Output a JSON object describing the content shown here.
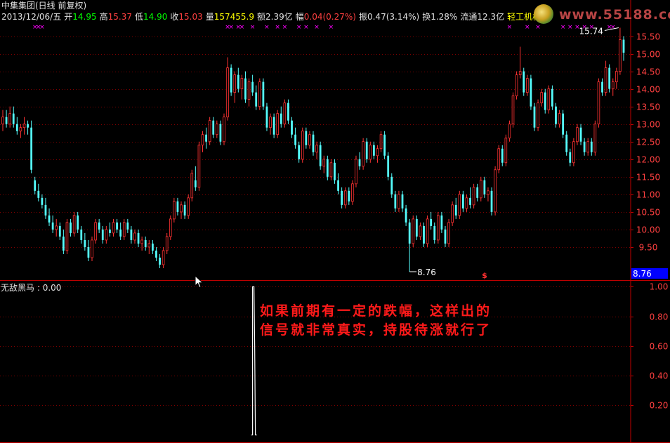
{
  "header": {
    "title": "中集集团(日线 前复权)",
    "date": "2013/12/06/五",
    "open_label": "开",
    "open": "14.95",
    "high_label": "高",
    "high": "15.37",
    "low_label": "低",
    "low": "14.90",
    "close_label": "收",
    "close": "15.03",
    "volume_label": "量",
    "volume": "157455.9",
    "amount_label": "额",
    "amount": "2.39亿",
    "change_label": "幅",
    "change": "0.04(0.27%)",
    "amplitude_label": "振",
    "amplitude": "0.47(3.14%)",
    "turnover_label": "换",
    "turnover": "1.28%",
    "float_label": "流通",
    "float_cap": "12.3亿",
    "sector": "轻工机械"
  },
  "indicator": {
    "name": "无敌黑马",
    "value": "0.00"
  },
  "annotation": {
    "line1": "如果前期有一定的跌幅，这样出的",
    "line2": "信号就非常真实，持股待涨就行了"
  },
  "watermark": {
    "text": "www.55188.com"
  },
  "colors": {
    "up": "#ff3232",
    "down": "#54fcfc",
    "grid": "#800000",
    "axis": "#c00000",
    "marker": "#ff00ff",
    "price_tag": "#0000ff",
    "indicator_line": "#ffffff",
    "annotation": "#ff1a1a"
  },
  "chart_data": [
    {
      "type": "candlestick",
      "y_ticks": [
        9.5,
        10.0,
        10.5,
        11.0,
        11.5,
        12.0,
        12.5,
        13.0,
        13.5,
        14.0,
        14.5,
        15.0,
        15.5
      ],
      "ylim": [
        8.58,
        15.93
      ],
      "period_high": 15.74,
      "period_low": 8.76,
      "current_price_tag": "8.76",
      "high_label": "15.74",
      "low_label": "8.76",
      "candles": [
        {
          "o": 13.0,
          "h": 13.4,
          "l": 12.8,
          "c": 13.2
        },
        {
          "o": 13.2,
          "h": 13.4,
          "l": 12.9,
          "c": 13.0
        },
        {
          "o": 13.0,
          "h": 13.5,
          "l": 12.9,
          "c": 13.3
        },
        {
          "o": 13.3,
          "h": 13.5,
          "l": 12.9,
          "c": 13.0
        },
        {
          "o": 13.0,
          "h": 13.2,
          "l": 12.7,
          "c": 12.8
        },
        {
          "o": 12.8,
          "h": 13.0,
          "l": 12.6,
          "c": 12.9
        },
        {
          "o": 12.9,
          "h": 13.2,
          "l": 12.7,
          "c": 13.0
        },
        {
          "o": 13.0,
          "h": 13.1,
          "l": 12.7,
          "c": 12.9
        },
        {
          "o": 12.9,
          "h": 13.1,
          "l": 11.6,
          "c": 11.7
        },
        {
          "o": 11.4,
          "h": 11.5,
          "l": 11.0,
          "c": 11.1
        },
        {
          "o": 11.1,
          "h": 11.3,
          "l": 10.8,
          "c": 10.9
        },
        {
          "o": 10.9,
          "h": 11.0,
          "l": 10.6,
          "c": 10.7
        },
        {
          "o": 10.7,
          "h": 10.9,
          "l": 10.3,
          "c": 10.4
        },
        {
          "o": 10.4,
          "h": 10.6,
          "l": 10.1,
          "c": 10.2
        },
        {
          "o": 10.2,
          "h": 10.4,
          "l": 9.9,
          "c": 10.0
        },
        {
          "o": 10.0,
          "h": 10.3,
          "l": 9.8,
          "c": 10.1
        },
        {
          "o": 10.1,
          "h": 10.2,
          "l": 9.7,
          "c": 9.8
        },
        {
          "o": 9.8,
          "h": 10.0,
          "l": 9.3,
          "c": 9.4
        },
        {
          "o": 9.4,
          "h": 10.3,
          "l": 9.3,
          "c": 10.2
        },
        {
          "o": 10.2,
          "h": 10.3,
          "l": 9.8,
          "c": 9.9
        },
        {
          "o": 9.9,
          "h": 10.5,
          "l": 9.8,
          "c": 10.4
        },
        {
          "o": 10.4,
          "h": 10.5,
          "l": 9.9,
          "c": 10.0
        },
        {
          "o": 10.0,
          "h": 10.1,
          "l": 9.6,
          "c": 9.7
        },
        {
          "o": 9.7,
          "h": 9.9,
          "l": 9.4,
          "c": 9.5
        },
        {
          "o": 9.5,
          "h": 9.7,
          "l": 9.1,
          "c": 9.2
        },
        {
          "o": 9.2,
          "h": 9.8,
          "l": 9.1,
          "c": 9.7
        },
        {
          "o": 9.7,
          "h": 10.3,
          "l": 9.6,
          "c": 10.2
        },
        {
          "o": 10.2,
          "h": 10.3,
          "l": 9.9,
          "c": 10.0
        },
        {
          "o": 10.0,
          "h": 10.1,
          "l": 9.6,
          "c": 9.7
        },
        {
          "o": 9.7,
          "h": 10.1,
          "l": 9.6,
          "c": 10.0
        },
        {
          "o": 10.0,
          "h": 10.2,
          "l": 9.8,
          "c": 9.9
        },
        {
          "o": 9.9,
          "h": 10.3,
          "l": 9.8,
          "c": 10.2
        },
        {
          "o": 10.2,
          "h": 10.3,
          "l": 9.9,
          "c": 10.0
        },
        {
          "o": 10.0,
          "h": 10.2,
          "l": 9.7,
          "c": 9.8
        },
        {
          "o": 9.8,
          "h": 10.3,
          "l": 9.7,
          "c": 10.2
        },
        {
          "o": 10.2,
          "h": 10.3,
          "l": 9.9,
          "c": 10.0
        },
        {
          "o": 10.0,
          "h": 10.1,
          "l": 9.6,
          "c": 9.7
        },
        {
          "o": 9.7,
          "h": 10.0,
          "l": 9.6,
          "c": 9.9
        },
        {
          "o": 9.9,
          "h": 10.0,
          "l": 9.5,
          "c": 9.6
        },
        {
          "o": 9.6,
          "h": 9.8,
          "l": 9.4,
          "c": 9.7
        },
        {
          "o": 9.7,
          "h": 9.8,
          "l": 9.4,
          "c": 9.5
        },
        {
          "o": 9.5,
          "h": 9.7,
          "l": 9.3,
          "c": 9.6
        },
        {
          "o": 9.6,
          "h": 9.7,
          "l": 9.3,
          "c": 9.4
        },
        {
          "o": 9.4,
          "h": 9.5,
          "l": 9.1,
          "c": 9.2
        },
        {
          "o": 9.2,
          "h": 9.3,
          "l": 8.9,
          "c": 9.0
        },
        {
          "o": 9.0,
          "h": 9.5,
          "l": 8.9,
          "c": 9.4
        },
        {
          "o": 9.4,
          "h": 9.9,
          "l": 9.3,
          "c": 9.8
        },
        {
          "o": 9.8,
          "h": 10.4,
          "l": 9.7,
          "c": 10.3
        },
        {
          "o": 10.3,
          "h": 10.9,
          "l": 10.2,
          "c": 10.8
        },
        {
          "o": 10.8,
          "h": 10.9,
          "l": 10.4,
          "c": 10.5
        },
        {
          "o": 10.5,
          "h": 10.8,
          "l": 10.3,
          "c": 10.7
        },
        {
          "o": 10.7,
          "h": 10.8,
          "l": 10.3,
          "c": 10.4
        },
        {
          "o": 10.4,
          "h": 11.0,
          "l": 10.3,
          "c": 10.9
        },
        {
          "o": 10.9,
          "h": 11.7,
          "l": 10.8,
          "c": 11.6
        },
        {
          "o": 11.4,
          "h": 11.8,
          "l": 11.1,
          "c": 11.2
        },
        {
          "o": 11.2,
          "h": 12.5,
          "l": 11.1,
          "c": 12.4
        },
        {
          "o": 12.4,
          "h": 12.8,
          "l": 12.2,
          "c": 12.7
        },
        {
          "o": 12.7,
          "h": 12.9,
          "l": 12.3,
          "c": 12.5
        },
        {
          "o": 12.5,
          "h": 13.2,
          "l": 12.4,
          "c": 13.1
        },
        {
          "o": 13.1,
          "h": 13.2,
          "l": 12.6,
          "c": 12.7
        },
        {
          "o": 12.7,
          "h": 13.1,
          "l": 12.6,
          "c": 13.0
        },
        {
          "o": 13.0,
          "h": 13.1,
          "l": 12.4,
          "c": 12.5
        },
        {
          "o": 12.5,
          "h": 13.3,
          "l": 12.4,
          "c": 13.2
        },
        {
          "o": 13.2,
          "h": 14.9,
          "l": 13.1,
          "c": 14.6
        },
        {
          "o": 14.6,
          "h": 14.7,
          "l": 13.8,
          "c": 13.9
        },
        {
          "o": 13.9,
          "h": 14.5,
          "l": 13.6,
          "c": 14.4
        },
        {
          "o": 14.4,
          "h": 14.6,
          "l": 13.9,
          "c": 14.0
        },
        {
          "o": 14.0,
          "h": 14.4,
          "l": 13.7,
          "c": 14.3
        },
        {
          "o": 14.3,
          "h": 14.5,
          "l": 13.6,
          "c": 13.7
        },
        {
          "o": 13.7,
          "h": 14.3,
          "l": 13.5,
          "c": 14.2
        },
        {
          "o": 14.2,
          "h": 14.4,
          "l": 13.8,
          "c": 13.9
        },
        {
          "o": 13.9,
          "h": 14.1,
          "l": 13.4,
          "c": 13.5
        },
        {
          "o": 13.5,
          "h": 14.3,
          "l": 13.4,
          "c": 14.2
        },
        {
          "o": 14.2,
          "h": 14.3,
          "l": 13.4,
          "c": 13.5
        },
        {
          "o": 13.5,
          "h": 13.6,
          "l": 12.8,
          "c": 12.9
        },
        {
          "o": 12.9,
          "h": 13.3,
          "l": 12.7,
          "c": 13.2
        },
        {
          "o": 13.2,
          "h": 13.3,
          "l": 12.6,
          "c": 12.7
        },
        {
          "o": 12.7,
          "h": 13.4,
          "l": 12.6,
          "c": 13.3
        },
        {
          "o": 13.3,
          "h": 13.5,
          "l": 12.9,
          "c": 13.0
        },
        {
          "o": 13.0,
          "h": 13.7,
          "l": 12.9,
          "c": 13.6
        },
        {
          "o": 13.6,
          "h": 13.7,
          "l": 13.0,
          "c": 13.1
        },
        {
          "o": 13.1,
          "h": 13.2,
          "l": 12.6,
          "c": 12.7
        },
        {
          "o": 12.7,
          "h": 12.9,
          "l": 12.3,
          "c": 12.4
        },
        {
          "o": 12.4,
          "h": 12.5,
          "l": 11.9,
          "c": 12.0
        },
        {
          "o": 12.0,
          "h": 12.9,
          "l": 11.9,
          "c": 12.8
        },
        {
          "o": 12.8,
          "h": 12.9,
          "l": 12.3,
          "c": 12.4
        },
        {
          "o": 12.4,
          "h": 12.8,
          "l": 12.3,
          "c": 12.7
        },
        {
          "o": 12.7,
          "h": 12.8,
          "l": 12.1,
          "c": 12.2
        },
        {
          "o": 12.2,
          "h": 12.5,
          "l": 12.0,
          "c": 12.4
        },
        {
          "o": 12.4,
          "h": 12.5,
          "l": 11.7,
          "c": 11.8
        },
        {
          "o": 11.8,
          "h": 12.1,
          "l": 11.6,
          "c": 12.0
        },
        {
          "o": 12.0,
          "h": 12.1,
          "l": 11.4,
          "c": 11.5
        },
        {
          "o": 11.5,
          "h": 12.0,
          "l": 11.4,
          "c": 11.9
        },
        {
          "o": 11.9,
          "h": 12.0,
          "l": 11.3,
          "c": 11.4
        },
        {
          "o": 11.4,
          "h": 11.6,
          "l": 11.0,
          "c": 11.1
        },
        {
          "o": 11.1,
          "h": 11.2,
          "l": 10.6,
          "c": 10.7
        },
        {
          "o": 10.7,
          "h": 11.2,
          "l": 10.6,
          "c": 11.1
        },
        {
          "o": 11.1,
          "h": 11.2,
          "l": 10.7,
          "c": 10.8
        },
        {
          "o": 10.8,
          "h": 11.4,
          "l": 10.7,
          "c": 11.3
        },
        {
          "o": 11.3,
          "h": 12.1,
          "l": 11.2,
          "c": 12.0
        },
        {
          "o": 12.0,
          "h": 12.2,
          "l": 11.7,
          "c": 11.8
        },
        {
          "o": 11.8,
          "h": 12.6,
          "l": 11.7,
          "c": 12.5
        },
        {
          "o": 12.5,
          "h": 12.6,
          "l": 11.9,
          "c": 12.0
        },
        {
          "o": 12.0,
          "h": 12.5,
          "l": 11.9,
          "c": 12.4
        },
        {
          "o": 12.4,
          "h": 12.5,
          "l": 12.0,
          "c": 12.1
        },
        {
          "o": 12.1,
          "h": 12.4,
          "l": 11.9,
          "c": 12.3
        },
        {
          "o": 12.3,
          "h": 12.8,
          "l": 12.2,
          "c": 12.7
        },
        {
          "o": 12.7,
          "h": 12.8,
          "l": 12.0,
          "c": 12.1
        },
        {
          "o": 12.1,
          "h": 12.2,
          "l": 11.4,
          "c": 11.5
        },
        {
          "o": 11.5,
          "h": 11.6,
          "l": 10.9,
          "c": 11.0
        },
        {
          "o": 11.0,
          "h": 11.1,
          "l": 10.5,
          "c": 10.6
        },
        {
          "o": 10.6,
          "h": 11.1,
          "l": 10.5,
          "c": 11.0
        },
        {
          "o": 11.0,
          "h": 11.1,
          "l": 10.5,
          "c": 10.6
        },
        {
          "o": 10.6,
          "h": 10.7,
          "l": 10.1,
          "c": 10.2
        },
        {
          "o": 10.2,
          "h": 10.3,
          "l": 8.8,
          "c": 9.6
        },
        {
          "o": 9.6,
          "h": 10.4,
          "l": 9.5,
          "c": 10.3
        },
        {
          "o": 10.3,
          "h": 10.4,
          "l": 9.7,
          "c": 9.8
        },
        {
          "o": 9.8,
          "h": 10.2,
          "l": 9.7,
          "c": 10.1
        },
        {
          "o": 10.1,
          "h": 10.2,
          "l": 9.5,
          "c": 9.6
        },
        {
          "o": 9.6,
          "h": 10.4,
          "l": 9.5,
          "c": 10.3
        },
        {
          "o": 10.3,
          "h": 10.5,
          "l": 10.0,
          "c": 10.1
        },
        {
          "o": 10.1,
          "h": 10.2,
          "l": 9.6,
          "c": 9.7
        },
        {
          "o": 9.7,
          "h": 10.5,
          "l": 9.6,
          "c": 10.4
        },
        {
          "o": 10.4,
          "h": 10.5,
          "l": 9.9,
          "c": 10.0
        },
        {
          "o": 10.0,
          "h": 10.1,
          "l": 9.5,
          "c": 9.6
        },
        {
          "o": 9.6,
          "h": 10.3,
          "l": 9.5,
          "c": 10.2
        },
        {
          "o": 10.2,
          "h": 10.8,
          "l": 10.1,
          "c": 10.7
        },
        {
          "o": 10.7,
          "h": 10.9,
          "l": 10.3,
          "c": 10.4
        },
        {
          "o": 10.4,
          "h": 11.1,
          "l": 10.3,
          "c": 11.0
        },
        {
          "o": 11.0,
          "h": 11.1,
          "l": 10.5,
          "c": 10.6
        },
        {
          "o": 10.6,
          "h": 11.0,
          "l": 10.5,
          "c": 10.9
        },
        {
          "o": 10.9,
          "h": 11.2,
          "l": 10.6,
          "c": 10.7
        },
        {
          "o": 10.7,
          "h": 11.3,
          "l": 10.6,
          "c": 11.2
        },
        {
          "o": 11.2,
          "h": 11.3,
          "l": 10.8,
          "c": 10.9
        },
        {
          "o": 10.9,
          "h": 11.5,
          "l": 10.8,
          "c": 11.4
        },
        {
          "o": 11.4,
          "h": 11.5,
          "l": 10.9,
          "c": 11.0
        },
        {
          "o": 11.0,
          "h": 11.2,
          "l": 10.8,
          "c": 11.1
        },
        {
          "o": 11.1,
          "h": 11.2,
          "l": 10.4,
          "c": 10.5
        },
        {
          "o": 10.5,
          "h": 11.8,
          "l": 10.4,
          "c": 11.7
        },
        {
          "o": 11.7,
          "h": 12.4,
          "l": 11.6,
          "c": 12.3
        },
        {
          "o": 12.3,
          "h": 12.4,
          "l": 11.8,
          "c": 11.9
        },
        {
          "o": 11.9,
          "h": 12.7,
          "l": 11.8,
          "c": 12.6
        },
        {
          "o": 12.6,
          "h": 13.1,
          "l": 12.5,
          "c": 13.0
        },
        {
          "o": 13.0,
          "h": 13.9,
          "l": 12.9,
          "c": 13.8
        },
        {
          "o": 13.8,
          "h": 14.5,
          "l": 13.7,
          "c": 14.4
        },
        {
          "o": 14.4,
          "h": 15.2,
          "l": 14.3,
          "c": 14.5
        },
        {
          "o": 14.5,
          "h": 14.6,
          "l": 13.8,
          "c": 13.9
        },
        {
          "o": 13.9,
          "h": 14.4,
          "l": 13.8,
          "c": 14.3
        },
        {
          "o": 14.3,
          "h": 14.4,
          "l": 13.4,
          "c": 13.5
        },
        {
          "o": 13.5,
          "h": 13.6,
          "l": 12.8,
          "c": 12.9
        },
        {
          "o": 12.9,
          "h": 13.7,
          "l": 12.8,
          "c": 13.6
        },
        {
          "o": 13.6,
          "h": 14.0,
          "l": 13.5,
          "c": 13.9
        },
        {
          "o": 13.9,
          "h": 14.0,
          "l": 13.3,
          "c": 13.4
        },
        {
          "o": 13.4,
          "h": 14.1,
          "l": 13.3,
          "c": 14.0
        },
        {
          "o": 14.0,
          "h": 14.1,
          "l": 13.4,
          "c": 13.5
        },
        {
          "o": 13.5,
          "h": 13.6,
          "l": 12.9,
          "c": 13.0
        },
        {
          "o": 13.0,
          "h": 13.4,
          "l": 12.9,
          "c": 13.3
        },
        {
          "o": 13.3,
          "h": 13.4,
          "l": 12.6,
          "c": 12.7
        },
        {
          "o": 12.7,
          "h": 12.8,
          "l": 12.1,
          "c": 12.2
        },
        {
          "o": 12.2,
          "h": 12.3,
          "l": 11.8,
          "c": 11.9
        },
        {
          "o": 11.9,
          "h": 12.6,
          "l": 11.8,
          "c": 12.5
        },
        {
          "o": 12.5,
          "h": 13.0,
          "l": 12.4,
          "c": 12.9
        },
        {
          "o": 12.9,
          "h": 13.0,
          "l": 12.4,
          "c": 12.5
        },
        {
          "o": 12.5,
          "h": 12.6,
          "l": 12.1,
          "c": 12.2
        },
        {
          "o": 12.2,
          "h": 12.6,
          "l": 12.1,
          "c": 12.5
        },
        {
          "o": 12.5,
          "h": 12.6,
          "l": 12.1,
          "c": 12.2
        },
        {
          "o": 12.2,
          "h": 13.1,
          "l": 12.1,
          "c": 13.0
        },
        {
          "o": 13.0,
          "h": 14.3,
          "l": 12.9,
          "c": 14.2
        },
        {
          "o": 14.2,
          "h": 14.3,
          "l": 13.8,
          "c": 13.9
        },
        {
          "o": 13.9,
          "h": 14.8,
          "l": 13.8,
          "c": 14.6
        },
        {
          "o": 14.6,
          "h": 14.7,
          "l": 13.9,
          "c": 14.0
        },
        {
          "o": 14.0,
          "h": 14.3,
          "l": 13.8,
          "c": 14.2
        },
        {
          "o": 14.2,
          "h": 14.6,
          "l": 14.0,
          "c": 14.5
        },
        {
          "o": 14.5,
          "h": 15.74,
          "l": 14.4,
          "c": 15.4
        },
        {
          "o": 15.4,
          "h": 15.5,
          "l": 14.8,
          "c": 15.03
        }
      ]
    },
    {
      "type": "line",
      "name": "无敌黑马",
      "y_ticks": [
        0.2,
        0.4,
        0.6,
        0.8,
        1.0
      ],
      "ylim": [
        -0.04,
        1.04
      ],
      "signals": [
        {
          "bar": 70,
          "value": 1.0
        },
        {
          "bar": 192,
          "value": 1.0
        }
      ]
    }
  ]
}
